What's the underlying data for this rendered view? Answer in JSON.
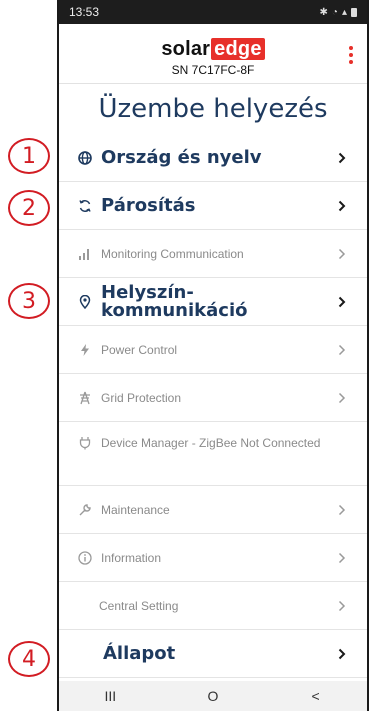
{
  "status_bar": {
    "time": "13:53",
    "icons": [
      "bluetooth-icon",
      "wifi-icon",
      "signal-icon",
      "battery-icon"
    ]
  },
  "header": {
    "logo_part1": "solar",
    "logo_part2": "edge",
    "serial": "SN 7C17FC-8F"
  },
  "page_title": "Üzembe helyezés",
  "callouts": [
    "1",
    "2",
    "3",
    "4"
  ],
  "menu": [
    {
      "label": "Ország és nyelv",
      "icon": "globe-icon",
      "style": "active"
    },
    {
      "label": "Párosítás",
      "icon": "sync-icon",
      "style": "active"
    },
    {
      "label": "Monitoring Communication",
      "icon": "bar-chart-icon",
      "style": "normal"
    },
    {
      "label": "Helyszín-kommunikáció",
      "icon": "location-pin-icon",
      "style": "active"
    },
    {
      "label": "Power Control",
      "icon": "lightning-icon",
      "style": "normal"
    },
    {
      "label": "Grid Protection",
      "icon": "transmission-tower-icon",
      "style": "normal"
    },
    {
      "label": "Device Manager - ZigBee Not Connected",
      "icon": "plug-icon",
      "style": "normal"
    },
    {
      "label": "Maintenance",
      "icon": "wrench-icon",
      "style": "normal"
    },
    {
      "label": "Information",
      "icon": "info-icon",
      "style": "normal"
    },
    {
      "label": "Central Setting",
      "icon": "",
      "style": "normal"
    },
    {
      "label": "Állapot",
      "icon": "",
      "style": "big"
    }
  ],
  "nav_bar": {
    "recents": "III",
    "home": "O",
    "back": "<"
  },
  "colors": {
    "accent": "#e7302a",
    "callout": "#d21c23",
    "title": "#1e3a5f"
  }
}
